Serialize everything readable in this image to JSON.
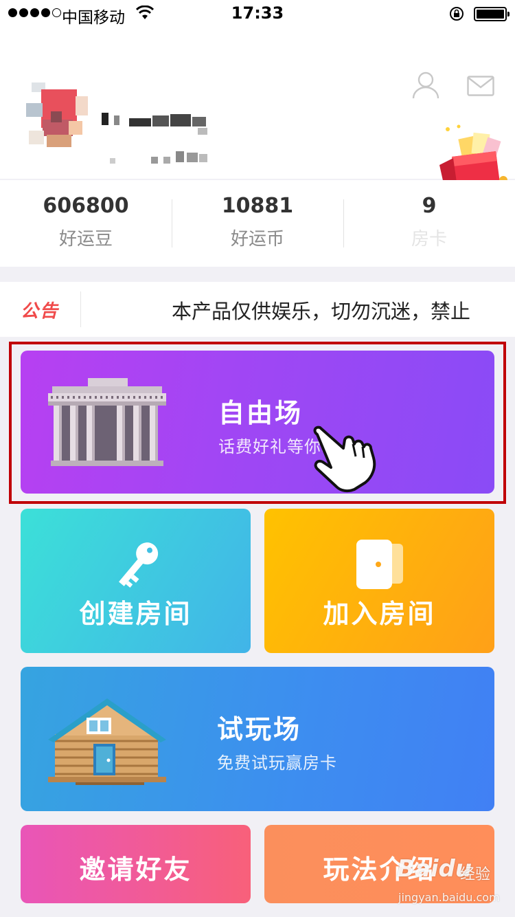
{
  "status_bar": {
    "carrier": "中国移动",
    "time": "17:33"
  },
  "header": {
    "user_icon": "user-icon",
    "mail_icon": "mail-icon",
    "gift_icon": "gift-box-icon"
  },
  "stats": [
    {
      "value": "606800",
      "label": "好运豆"
    },
    {
      "value": "10881",
      "label": "好运币"
    },
    {
      "value": "9",
      "label": "房卡"
    }
  ],
  "notice": {
    "tag": "公告",
    "text": "本产品仅供娱乐，切勿沉迷，禁止"
  },
  "cards": {
    "free": {
      "title": "自由场",
      "subtitle": "话费好礼等你拿"
    },
    "create": {
      "title": "创建房间"
    },
    "join": {
      "title": "加入房间"
    },
    "trial": {
      "title": "试玩场",
      "subtitle": "免费试玩赢房卡"
    },
    "invite": {
      "title": "邀请好友"
    },
    "rules": {
      "title": "玩法介绍"
    }
  },
  "watermark": {
    "brand": "Baidu",
    "label": "经验",
    "site": "jingyan.baidu.com"
  },
  "colors": {
    "free_card": "#9e47f4",
    "create_card": "#41c9e0",
    "join_card": "#ffad0c",
    "trial_card": "#3d8df0",
    "invite_card": "#f05c98",
    "rules_card": "#fd8f5b",
    "notice_tag": "#f04a4a",
    "highlight": "#c00006"
  }
}
